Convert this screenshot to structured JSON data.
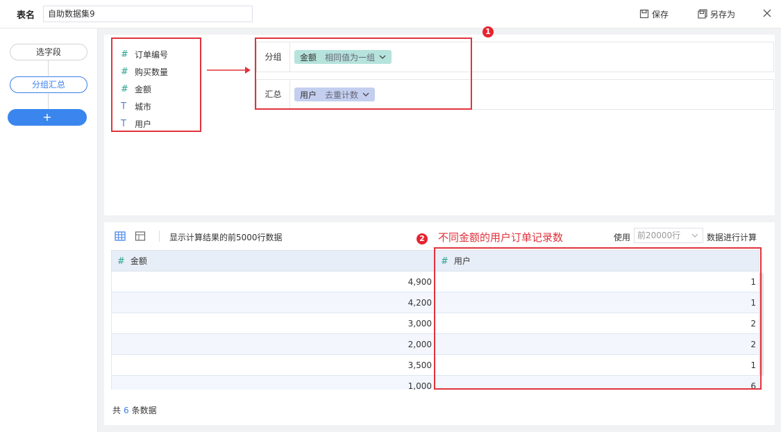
{
  "header": {
    "table_name_label": "表名",
    "table_name_value": "自助数据集9",
    "save_label": "保存",
    "save_as_label": "另存为"
  },
  "steps": {
    "select_fields": "选字段",
    "group_summary": "分组汇总",
    "add": "+"
  },
  "fields": [
    {
      "type": "number",
      "icon": "#",
      "label": "订单编号"
    },
    {
      "type": "number",
      "icon": "#",
      "label": "购买数量"
    },
    {
      "type": "number",
      "icon": "#",
      "label": "金额"
    },
    {
      "type": "text",
      "icon": "T",
      "label": "城市"
    },
    {
      "type": "text",
      "icon": "T",
      "label": "用户"
    }
  ],
  "config": {
    "group_label": "分组",
    "group_chip": {
      "field": "金额",
      "mode": "相同值为一组"
    },
    "summary_label": "汇总",
    "summary_chip": {
      "field": "用户",
      "mode": "去重计数"
    }
  },
  "badges": {
    "one": "1",
    "two": "2"
  },
  "result": {
    "show_text": "显示计算结果的前5000行数据",
    "annotation": "不同金额的用户订单记录数",
    "use_label": "使用",
    "rows_option": "前20000行",
    "calc_label": "数据进行计算",
    "columns": [
      {
        "icon": "#",
        "label": "金额"
      },
      {
        "icon": "#",
        "label": "用户"
      }
    ],
    "rows": [
      {
        "amount": "4,900",
        "users": "1"
      },
      {
        "amount": "4,200",
        "users": "1"
      },
      {
        "amount": "3,000",
        "users": "2"
      },
      {
        "amount": "2,000",
        "users": "2"
      },
      {
        "amount": "3,500",
        "users": "1"
      },
      {
        "amount": "1,000",
        "users": "6"
      }
    ],
    "footer_prefix": "共",
    "footer_count": "6",
    "footer_suffix": "条数据"
  },
  "colors": {
    "accent": "#3b86ee",
    "highlight_red": "#e0323c",
    "number_icon": "#2aa38f",
    "group_chip": "#b6e3dc",
    "summary_chip": "#c4cff0"
  }
}
